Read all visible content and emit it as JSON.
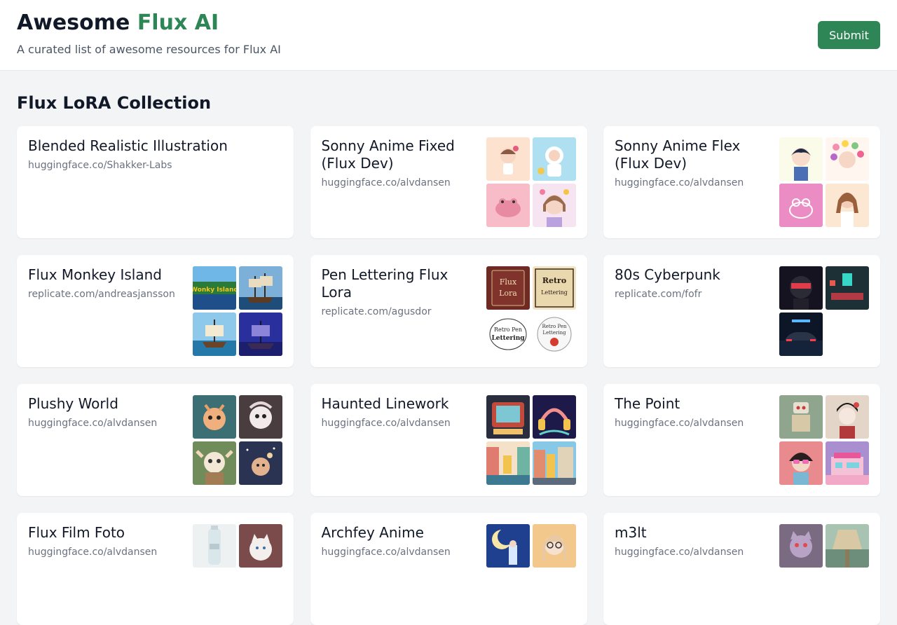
{
  "header": {
    "title_prefix": "Awesome",
    "title_accent": "Flux AI",
    "subtitle": "A curated list of awesome resources for Flux AI",
    "submit_label": "Submit",
    "accent_color": "#2e8556"
  },
  "section": {
    "title": "Flux LoRA Collection"
  },
  "cards": [
    {
      "title": "Blended Realistic Illustration",
      "link": "huggingface.co/Shakker-Labs",
      "thumbs": []
    },
    {
      "title": "Sonny Anime Fixed (Flux Dev)",
      "link": "huggingface.co/alvdansen",
      "thumbs": [
        "thumb-anime-chibi",
        "thumb-anime-astronaut",
        "thumb-pink-frog",
        "thumb-anime-girl-flowers"
      ]
    },
    {
      "title": "Sonny Anime Flex (Flux Dev)",
      "link": "huggingface.co/alvdansen",
      "thumbs": [
        "thumb-anime-boy",
        "thumb-anime-flower-girl",
        "thumb-pink-frog-sketch",
        "thumb-anime-girl-casual"
      ]
    },
    {
      "title": "Flux Monkey Island",
      "link": "replicate.com/andreasjansson",
      "thumbs": [
        "thumb-monkey-island-logo",
        "thumb-pirate-ship-dock",
        "thumb-pirate-ship-sea",
        "thumb-pirate-ship-night"
      ]
    },
    {
      "title": "Pen Lettering Flux Lora",
      "link": "replicate.com/agusdor",
      "thumbs": [
        "thumb-flux-lora-book",
        "thumb-retro-lettering-sign",
        "thumb-retro-pen-lettering-bw",
        "thumb-retro-pen-lettering-red"
      ]
    },
    {
      "title": "80s Cyberpunk",
      "link": "replicate.com/fofr",
      "thumbs": [
        "thumb-cyberpunk-helmet",
        "thumb-cyberpunk-room",
        "thumb-cyberpunk-car"
      ]
    },
    {
      "title": "Plushy World",
      "link": "huggingface.co/alvdansen",
      "thumbs": [
        "thumb-plushy-deer",
        "thumb-plushy-creature",
        "thumb-plushy-gnome",
        "thumb-plushy-space"
      ]
    },
    {
      "title": "Haunted Linework",
      "link": "huggingface.co/alvdansen",
      "thumbs": [
        "thumb-retro-tv",
        "thumb-headphones",
        "thumb-street-scene",
        "thumb-city-street"
      ]
    },
    {
      "title": "The Point",
      "link": "huggingface.co/alvdansen",
      "thumbs": [
        "thumb-robot-figure",
        "thumb-geisha",
        "thumb-girl-glasses",
        "thumb-diner"
      ]
    },
    {
      "title": "Flux Film Foto",
      "link": "huggingface.co/alvdansen",
      "thumbs": [
        "thumb-water-bottle",
        "thumb-white-kitten"
      ]
    },
    {
      "title": "Archfey Anime",
      "link": "huggingface.co/alvdansen",
      "thumbs": [
        "thumb-moon-girl",
        "thumb-blonde-glasses"
      ]
    },
    {
      "title": "m3lt",
      "link": "huggingface.co/alvdansen",
      "thumbs": [
        "thumb-cat-mask",
        "thumb-bridge-landscape"
      ]
    }
  ]
}
